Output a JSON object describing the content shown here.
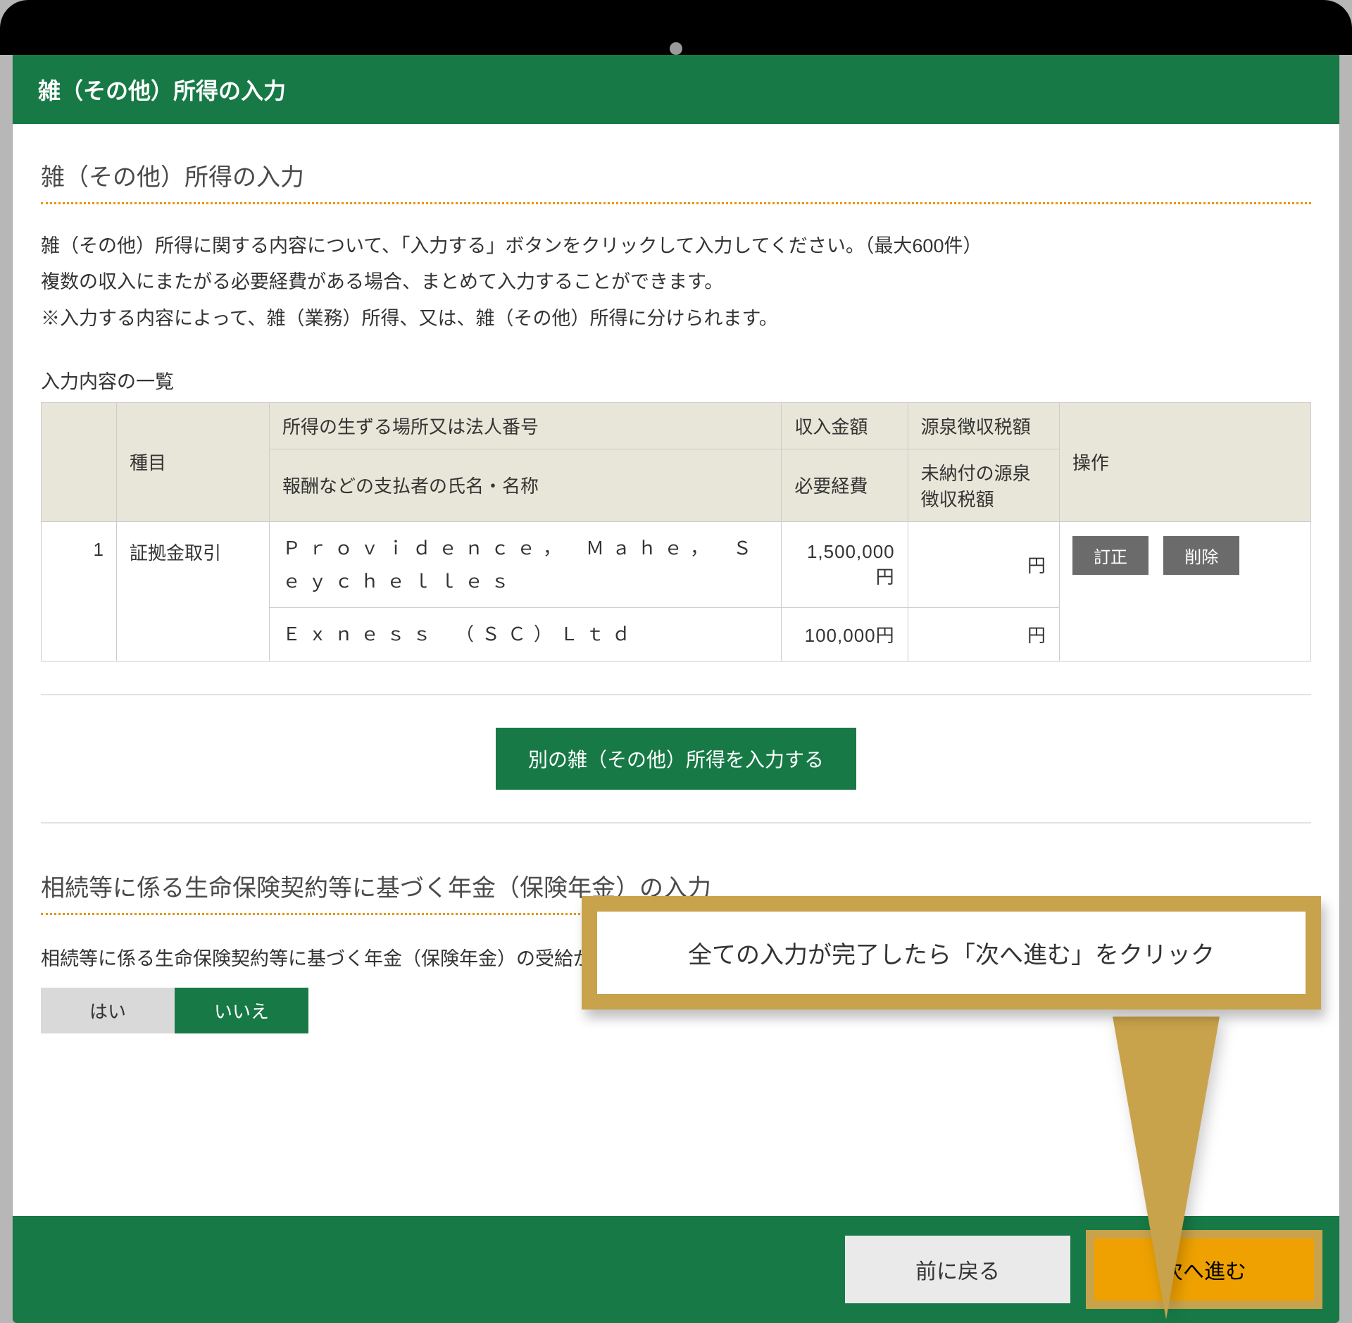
{
  "header": {
    "title": "雑（その他）所得の入力"
  },
  "section1": {
    "title": "雑（その他）所得の入力",
    "intro": [
      "雑（その他）所得に関する内容について、「入力する」ボタンをクリックして入力してください。（最大600件）",
      "複数の収入にまたがる必要経費がある場合、まとめて入力することができます。",
      "※入力する内容によって、雑（業務）所得、又は、雑（その他）所得に分けられます。"
    ],
    "list_label": "入力内容の一覧"
  },
  "table": {
    "head": {
      "kind": "種目",
      "place": "所得の生ずる場所又は法人番号",
      "income": "収入金額",
      "withholding": "源泉徴収税額",
      "actions": "操作",
      "payer": "報酬などの支払者の氏名・名称",
      "expense": "必要経費",
      "unpaid": "未納付の源泉徴収税額"
    },
    "rows": [
      {
        "no": "1",
        "kind": "証拠金取引",
        "place": "Ｐｒｏｖｉｄｅｎｃｅ，　Ｍａｈｅ，　Ｓｅｙｃｈｅｌｌｅｓ",
        "income": "1,500,000円",
        "withholding": "円",
        "payer": "Ｅｘｎｅｓｓ　（ＳＣ）Ｌｔｄ",
        "expense": "100,000円",
        "unpaid": "円"
      }
    ],
    "edit": "訂正",
    "delete": "削除"
  },
  "add_button": "別の雑（その他）所得を入力する",
  "callout": "全ての入力が完了したら「次へ進む」をクリック",
  "section2": {
    "title": "相続等に係る生命保険契約等に基づく年金（保険年金）の入力",
    "question": "相続等に係る生命保険契約等に基づく年金（保険年金）の受給がありますか？",
    "yes": "はい",
    "no": "いいえ"
  },
  "footer": {
    "back": "前に戻る",
    "next": "次へ進む"
  }
}
